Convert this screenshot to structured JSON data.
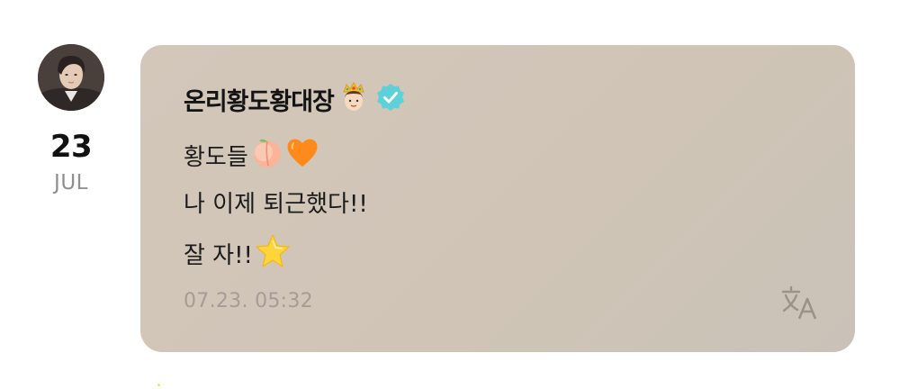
{
  "post": {
    "date_day": "23",
    "date_month": "JUL",
    "sender_name": "온리황도황대장",
    "sender_badges": [
      "crown-prince-emoji",
      "verified-badge-icon"
    ],
    "lines": [
      {
        "text": "황도들",
        "emojis": [
          "peach-emoji",
          "orange-heart-emoji"
        ]
      },
      {
        "text": "나 이제 퇴근했다!!",
        "emojis": []
      },
      {
        "text": "잘 자!!",
        "emojis": [
          "star-emoji"
        ]
      }
    ],
    "timestamp": "07.23. 05:32",
    "translate_icon": "translate-icon"
  },
  "colors": {
    "bubble": "#d3c7ba",
    "verified": "#5ed0d8",
    "timestamp": "#a59d94",
    "month": "#8f8f8f"
  }
}
